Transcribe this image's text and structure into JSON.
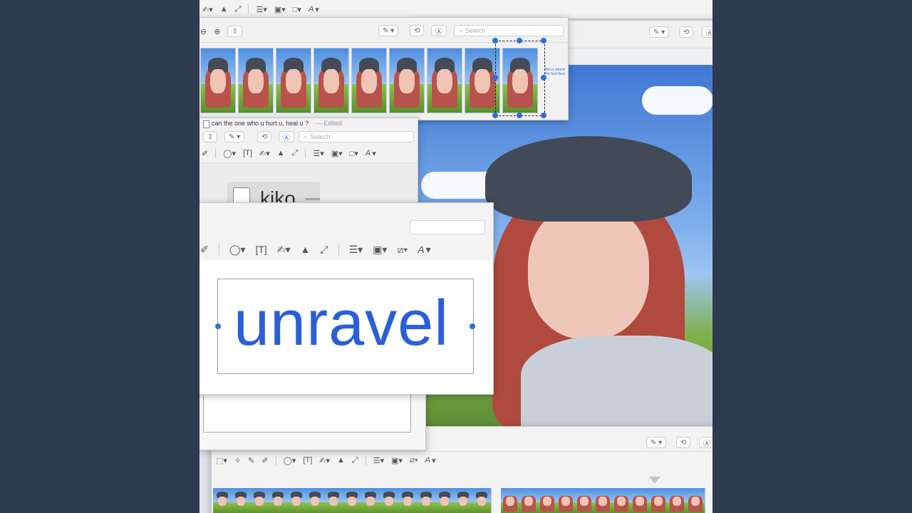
{
  "top_toolbar": {
    "tools": [
      {
        "icon": "signature-icon"
      },
      {
        "icon": "adjust-color-icon"
      },
      {
        "icon": "resize-icon"
      },
      {
        "icon": "shape-style-icon"
      },
      {
        "icon": "border-color-icon"
      },
      {
        "icon": "fill-color-icon"
      },
      {
        "icon": "text-style-icon"
      }
    ]
  },
  "thumbnail_window": {
    "search_placeholder": "Search",
    "thumbnails": 9,
    "selection_note": "this is where the hurt lives"
  },
  "file_window": {
    "title": "can the one who u hurt u, heal u ?",
    "edited_label": "— Edited",
    "search_placeholder": "Search",
    "file_name": "kiko"
  },
  "unravel_window": {
    "text": "unravel"
  },
  "background_window": {
    "partial_label": "n"
  },
  "lower_window": {
    "text": "unravel"
  },
  "colors": {
    "accent": "#2f6fd6",
    "unravel_text": "#2b5fd9",
    "desktop": "#2e3a4f"
  }
}
